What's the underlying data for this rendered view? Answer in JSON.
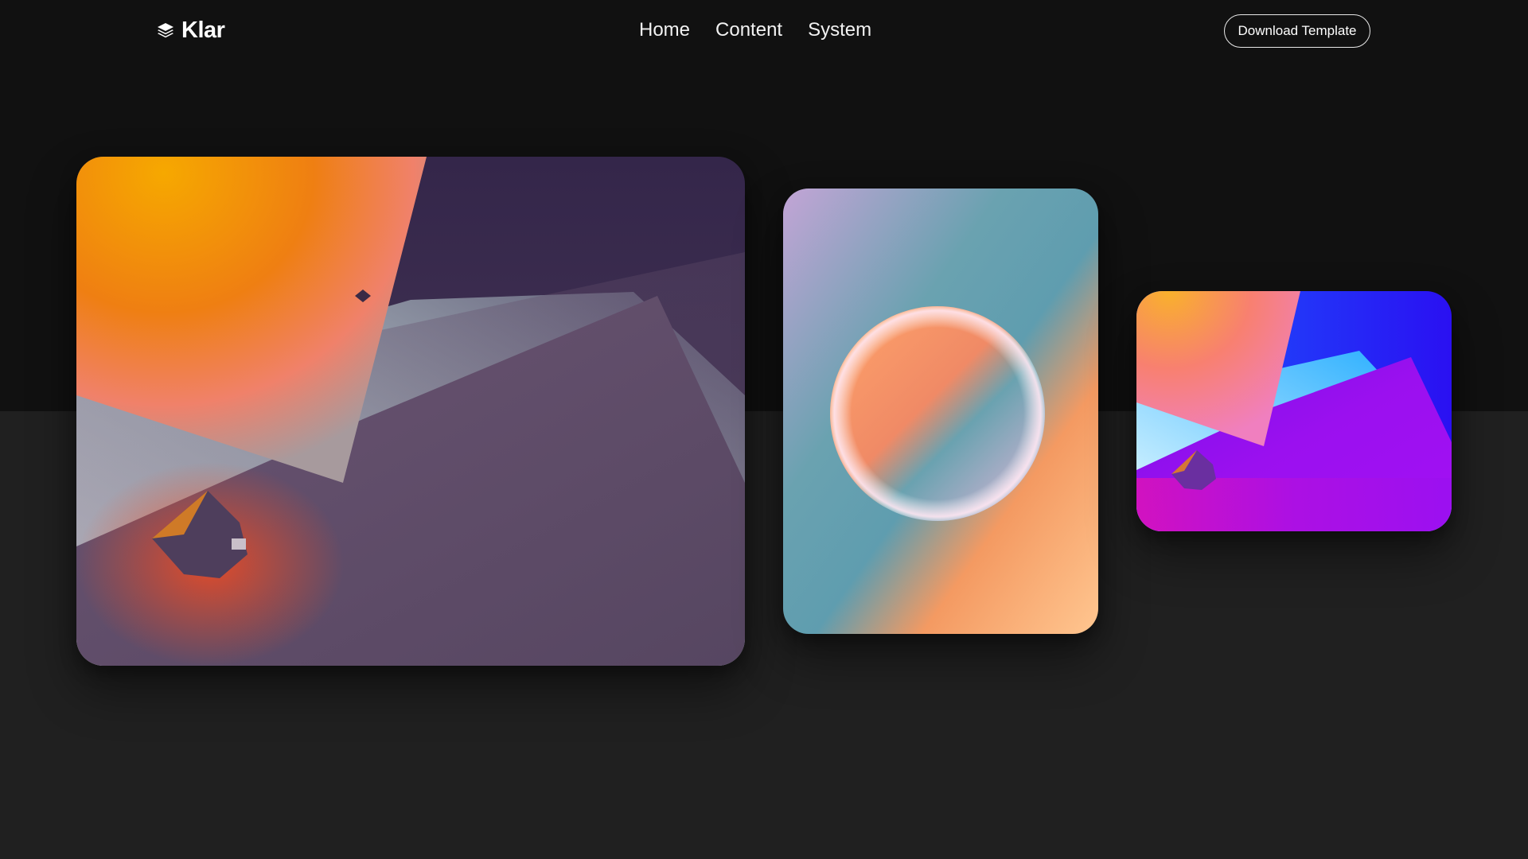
{
  "header": {
    "brand": {
      "name": "Klar",
      "icon": "layers-icon"
    },
    "nav": [
      {
        "label": "Home"
      },
      {
        "label": "Content"
      },
      {
        "label": "System"
      }
    ],
    "cta_label": "Download Template"
  },
  "gallery": {
    "items": [
      {
        "kind": "abstract-3d-render",
        "palette": [
          "#f7a400",
          "#ef7a14",
          "#3a2a4e",
          "#5e4a6a",
          "#dfeaea"
        ]
      },
      {
        "kind": "glass-sphere-gradient",
        "palette": [
          "#c3a4d6",
          "#6aa0b0",
          "#f49a62",
          "#ffc08f"
        ]
      },
      {
        "kind": "abstract-3d-render",
        "palette": [
          "#f9b13a",
          "#1a16f0",
          "#9d10f0",
          "#e310c0",
          "#63cfff"
        ]
      }
    ]
  },
  "colors": {
    "page_background": "#202020",
    "header_band": "#111111",
    "text": "#ffffff"
  }
}
